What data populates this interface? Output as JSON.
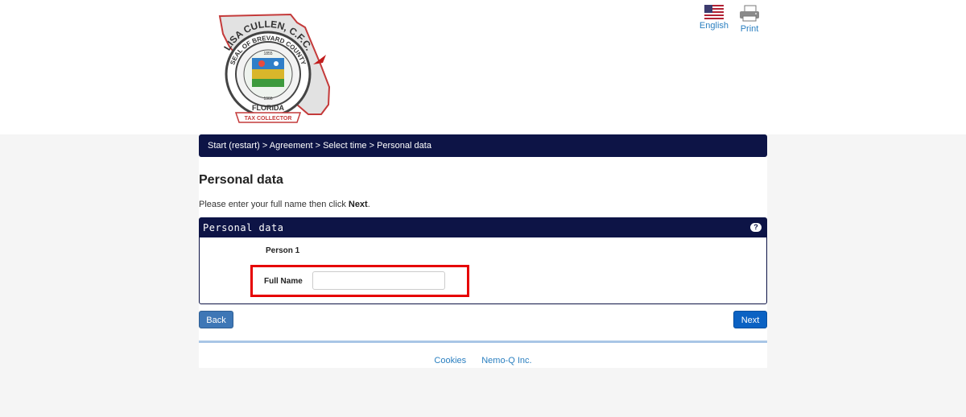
{
  "header": {
    "logo": {
      "icon": "county-seal-logo",
      "top_text": "LISA CULLEN, C.F.C.",
      "ring_text": "SEAL OF BREVARD COUNTY",
      "banner_text": "FLORIDA",
      "ribbon_text": "TAX COLLECTOR",
      "year_top": "1855",
      "year_bottom": "1966"
    },
    "language_label": "English",
    "language_icon": "us-flag-icon",
    "print_label": "Print",
    "print_icon": "printer-icon"
  },
  "breadcrumb": {
    "start": "Start (restart)",
    "sep": " > ",
    "agreement": "Agreement",
    "select_time": "Select time",
    "current": "Personal data"
  },
  "page": {
    "title": "Personal data",
    "instruction_prefix": "Please enter your full name then click ",
    "instruction_bold": "Next",
    "instruction_suffix": "."
  },
  "panel": {
    "title": "Personal data",
    "help_icon": "?",
    "person_label": "Person 1",
    "full_name_label": "Full Name",
    "full_name_value": "",
    "full_name_placeholder": ""
  },
  "buttons": {
    "back": "Back",
    "next": "Next"
  },
  "footer": {
    "cookies": "Cookies",
    "company": "Nemo-Q Inc."
  },
  "colors": {
    "navy": "#0d1446",
    "link": "#2a7fc0",
    "highlight": "#e60000",
    "back_button": "#3e77b6",
    "next_button": "#0b62c3"
  }
}
